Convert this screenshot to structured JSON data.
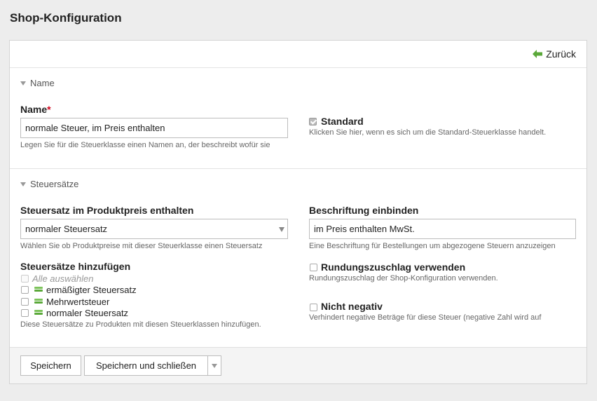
{
  "page": {
    "title": "Shop-Konfiguration"
  },
  "topbar": {
    "back_label": "Zurück"
  },
  "section_name": {
    "title": "Name",
    "name_label": "Name",
    "name_required": "*",
    "name_value": "normale Steuer, im Preis enthalten",
    "name_help": "Legen Sie für die Steuerklasse einen Namen an, der beschreibt wofür sie",
    "standard_label": "Standard",
    "standard_checked": true,
    "standard_help": "Klicken Sie hier, wenn es sich um die Standard-Steuerklasse handelt."
  },
  "section_rates": {
    "title": "Steuersätze",
    "included_label": "Steuersatz im Produktpreis enthalten",
    "included_value": "normaler Steuersatz",
    "included_help": "Wählen Sie ob Produktpreise mit dieser Steuerklasse einen Steuersatz",
    "caption_label": "Beschriftung einbinden",
    "caption_value": "im Preis enthalten MwSt.",
    "caption_help": "Eine Beschriftung für Bestellungen um abgezogene Steuern anzuzeigen",
    "add_label": "Steuersätze hinzufügen",
    "select_all": "Alle auswählen",
    "rates": [
      {
        "label": "ermäßigter Steuersatz",
        "checked": false
      },
      {
        "label": "Mehrwertsteuer",
        "checked": false
      },
      {
        "label": "normaler Steuersatz",
        "checked": false
      }
    ],
    "add_help": "Diese Steuersätze zu Produkten mit diesen Steuerklassen hinzufügen.",
    "rounding_label": "Rundungszuschlag verwenden",
    "rounding_help": "Rundungszuschlag der Shop-Konfiguration verwenden.",
    "nonneg_label": "Nicht negativ",
    "nonneg_help": "Verhindert negative Beträge für diese Steuer (negative Zahl wird auf"
  },
  "footer": {
    "save_label": "Speichern",
    "save_close_label": "Speichern und schließen"
  },
  "colors": {
    "accent_green": "#5aa839",
    "required_red": "#d0021b"
  }
}
